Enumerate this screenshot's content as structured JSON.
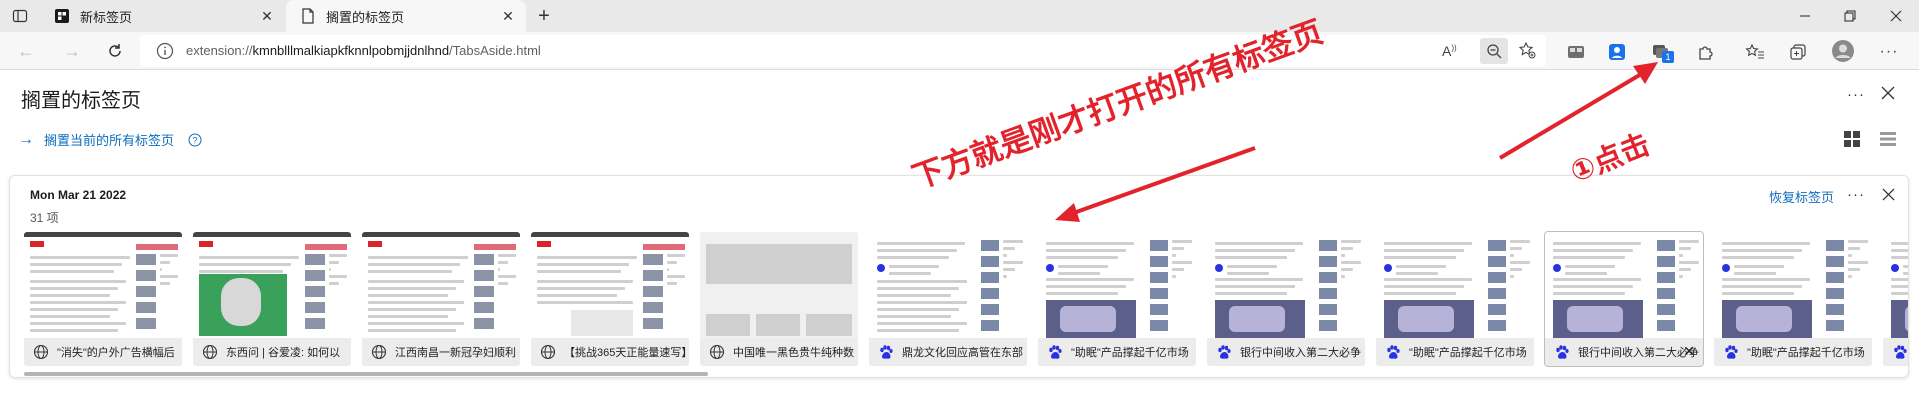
{
  "tabs": [
    {
      "title": "新标签页",
      "icon": "edge-newtab-icon"
    },
    {
      "title": "搁置的标签页",
      "icon": "page-icon"
    }
  ],
  "address_bar": {
    "url_prefix": "extension://",
    "url_host": "kmnblllmalkiapkfknnlpobmjjdnlhnd",
    "url_path": "/TabsAside.html",
    "extension_badge": "1"
  },
  "page": {
    "title": "搁置的标签页",
    "set_aside_label": "搁置当前的所有标签页"
  },
  "group": {
    "date": "Mon Mar 21 2022",
    "count": "31 项",
    "restore_label": "恢复标签页",
    "thumbnails": [
      {
        "caption": "\"消失\"的户外广告横幅后",
        "icon": "globe-icon",
        "kind": "news-photo"
      },
      {
        "caption": "东西问 | 谷爱凌: 如何以",
        "icon": "globe-icon",
        "kind": "news-skier"
      },
      {
        "caption": "江西南昌一新冠孕妇顺利",
        "icon": "globe-icon",
        "kind": "news-photo"
      },
      {
        "caption": "【挑战365天正能量速写】",
        "icon": "globe-icon",
        "kind": "news-sketch"
      },
      {
        "caption": "中国唯一黑色贵牛纯种数",
        "icon": "globe-icon",
        "kind": "loading"
      },
      {
        "caption": "鼎龙文化回应高管在东部",
        "icon": "baidu-paw-icon",
        "kind": "baidu-text"
      },
      {
        "caption": "\"助眠\"产品撑起千亿市场",
        "icon": "baidu-paw-icon",
        "kind": "baidu-photo"
      },
      {
        "caption": "银行中间收入第二大必争",
        "icon": "baidu-paw-icon",
        "kind": "baidu-photo"
      },
      {
        "caption": "\"助眠\"产品撑起千亿市场",
        "icon": "baidu-paw-icon",
        "kind": "baidu-photo"
      },
      {
        "caption": "银行中间收入第二大必争",
        "icon": "baidu-paw-icon",
        "kind": "baidu-photo-hover"
      },
      {
        "caption": "\"助眠\"产品撑起千亿市场",
        "icon": "baidu-paw-icon",
        "kind": "baidu-photo"
      },
      {
        "caption": "",
        "icon": "baidu-paw-icon",
        "kind": "baidu-photo-partial"
      }
    ]
  },
  "annotations": {
    "arrow_text": "下方就是刚才打开的所有标签页",
    "step_text": "①点击",
    "color": "#e3232c"
  },
  "colors": {
    "accent": "#0f6cbd",
    "tabstrip": "#e9e9e9",
    "toolbar": "#f7f7f7"
  }
}
